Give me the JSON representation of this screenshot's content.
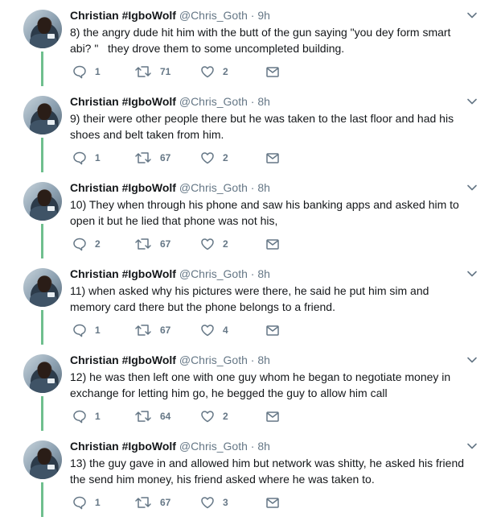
{
  "colors": {
    "thread_line": "#6fbf8e",
    "meta_text": "#657786",
    "body_text": "#14171a"
  },
  "icons": {
    "reply": "reply-icon",
    "retweet": "retweet-icon",
    "like": "heart-icon",
    "message": "envelope-icon",
    "more": "chevron-down-icon"
  },
  "tweets": [
    {
      "name": "Christian #IgboWolf",
      "handle": "@Chris_Goth",
      "separator": "·",
      "time": "9h",
      "text": "8) the angry dude hit him with the butt of the gun saying \"you dey form smart abi? \"   they drove them to some uncompleted building.",
      "replies": "1",
      "retweets": "71",
      "likes": "2"
    },
    {
      "name": "Christian #IgboWolf",
      "handle": "@Chris_Goth",
      "separator": "·",
      "time": "8h",
      "text": "9) their were other people there but he was taken to the last floor and had his shoes and belt taken from him.",
      "replies": "1",
      "retweets": "67",
      "likes": "2"
    },
    {
      "name": "Christian #IgboWolf",
      "handle": "@Chris_Goth",
      "separator": "·",
      "time": "8h",
      "text": "10) They when through his phone and saw his banking apps and asked him to open it but he lied that phone was not his,",
      "replies": "2",
      "retweets": "67",
      "likes": "2"
    },
    {
      "name": "Christian #IgboWolf",
      "handle": "@Chris_Goth",
      "separator": "·",
      "time": "8h",
      "text": "11) when asked why his pictures were there, he said he put him sim and memory card there but the phone belongs to a friend.",
      "replies": "1",
      "retweets": "67",
      "likes": "4"
    },
    {
      "name": "Christian #IgboWolf",
      "handle": "@Chris_Goth",
      "separator": "·",
      "time": "8h",
      "text": "12) he was then left one with one guy whom he began to negotiate money in exchange for letting him go, he begged the guy to allow him call",
      "replies": "1",
      "retweets": "64",
      "likes": "2"
    },
    {
      "name": "Christian #IgboWolf",
      "handle": "@Chris_Goth",
      "separator": "·",
      "time": "8h",
      "text": "13) the guy gave in and allowed him but network was shitty, he asked his friend the send him money, his friend asked where he was taken to.",
      "replies": "1",
      "retweets": "67",
      "likes": "3"
    }
  ]
}
